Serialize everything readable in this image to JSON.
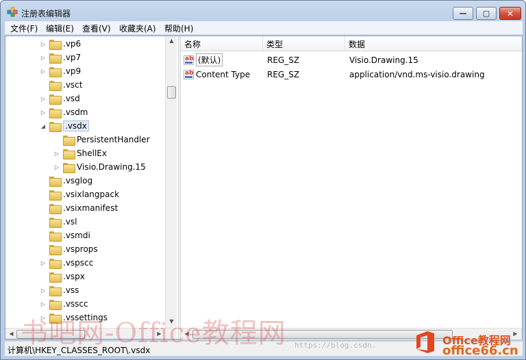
{
  "window": {
    "title": "注册表编辑器",
    "controls": {
      "minimize": "—",
      "maximize": "▢",
      "close": "✕"
    }
  },
  "menu": [
    "文件(F)",
    "编辑(E)",
    "查看(V)",
    "收藏夹(A)",
    "帮助(H)"
  ],
  "tree": {
    "items": [
      {
        "label": ".vp6",
        "expandable": true,
        "level": 0
      },
      {
        "label": ".vp7",
        "expandable": true,
        "level": 0
      },
      {
        "label": ".vp9",
        "expandable": true,
        "level": 0
      },
      {
        "label": ".vsct",
        "expandable": false,
        "level": 0
      },
      {
        "label": ".vsd",
        "expandable": true,
        "level": 0
      },
      {
        "label": ".vsdm",
        "expandable": true,
        "level": 0
      },
      {
        "label": ".vsdx",
        "expandable": true,
        "expanded": true,
        "level": 0,
        "selected": true
      },
      {
        "label": "PersistentHandler",
        "expandable": false,
        "level": 1
      },
      {
        "label": "ShellEx",
        "expandable": true,
        "level": 1
      },
      {
        "label": "Visio.Drawing.15",
        "expandable": true,
        "level": 1
      },
      {
        "label": ".vsglog",
        "expandable": false,
        "level": 0
      },
      {
        "label": ".vsixlangpack",
        "expandable": false,
        "level": 0
      },
      {
        "label": ".vsixmanifest",
        "expandable": false,
        "level": 0
      },
      {
        "label": ".vsl",
        "expandable": false,
        "level": 0
      },
      {
        "label": ".vsmdi",
        "expandable": false,
        "level": 0
      },
      {
        "label": ".vsprops",
        "expandable": false,
        "level": 0
      },
      {
        "label": ".vspscc",
        "expandable": true,
        "level": 0
      },
      {
        "label": ".vspx",
        "expandable": false,
        "level": 0
      },
      {
        "label": ".vss",
        "expandable": true,
        "level": 0
      },
      {
        "label": ".vsscc",
        "expandable": true,
        "level": 0
      },
      {
        "label": ".vssettings",
        "expandable": true,
        "level": 0
      }
    ]
  },
  "list": {
    "columns": [
      "名称",
      "类型",
      "数据"
    ],
    "rows": [
      {
        "name": "(默认)",
        "type": "REG_SZ",
        "data": "Visio.Drawing.15",
        "icon": "string-value-icon"
      },
      {
        "name": "Content Type",
        "type": "REG_SZ",
        "data": "application/vnd.ms-visio.drawing",
        "icon": "string-value-icon"
      }
    ]
  },
  "status": {
    "path": "计算机\\HKEY_CLASSES_ROOT\\.vsdx"
  },
  "watermark": {
    "left_text": "书吧网-Office教程网",
    "mid_text": "https://blog.csdn.",
    "brand_line1": "Office教程网",
    "brand_line2": "office66.cn"
  },
  "colors": {
    "accent": "#3399ff",
    "folder": "#e6be4f",
    "brand": "#e0691f"
  }
}
